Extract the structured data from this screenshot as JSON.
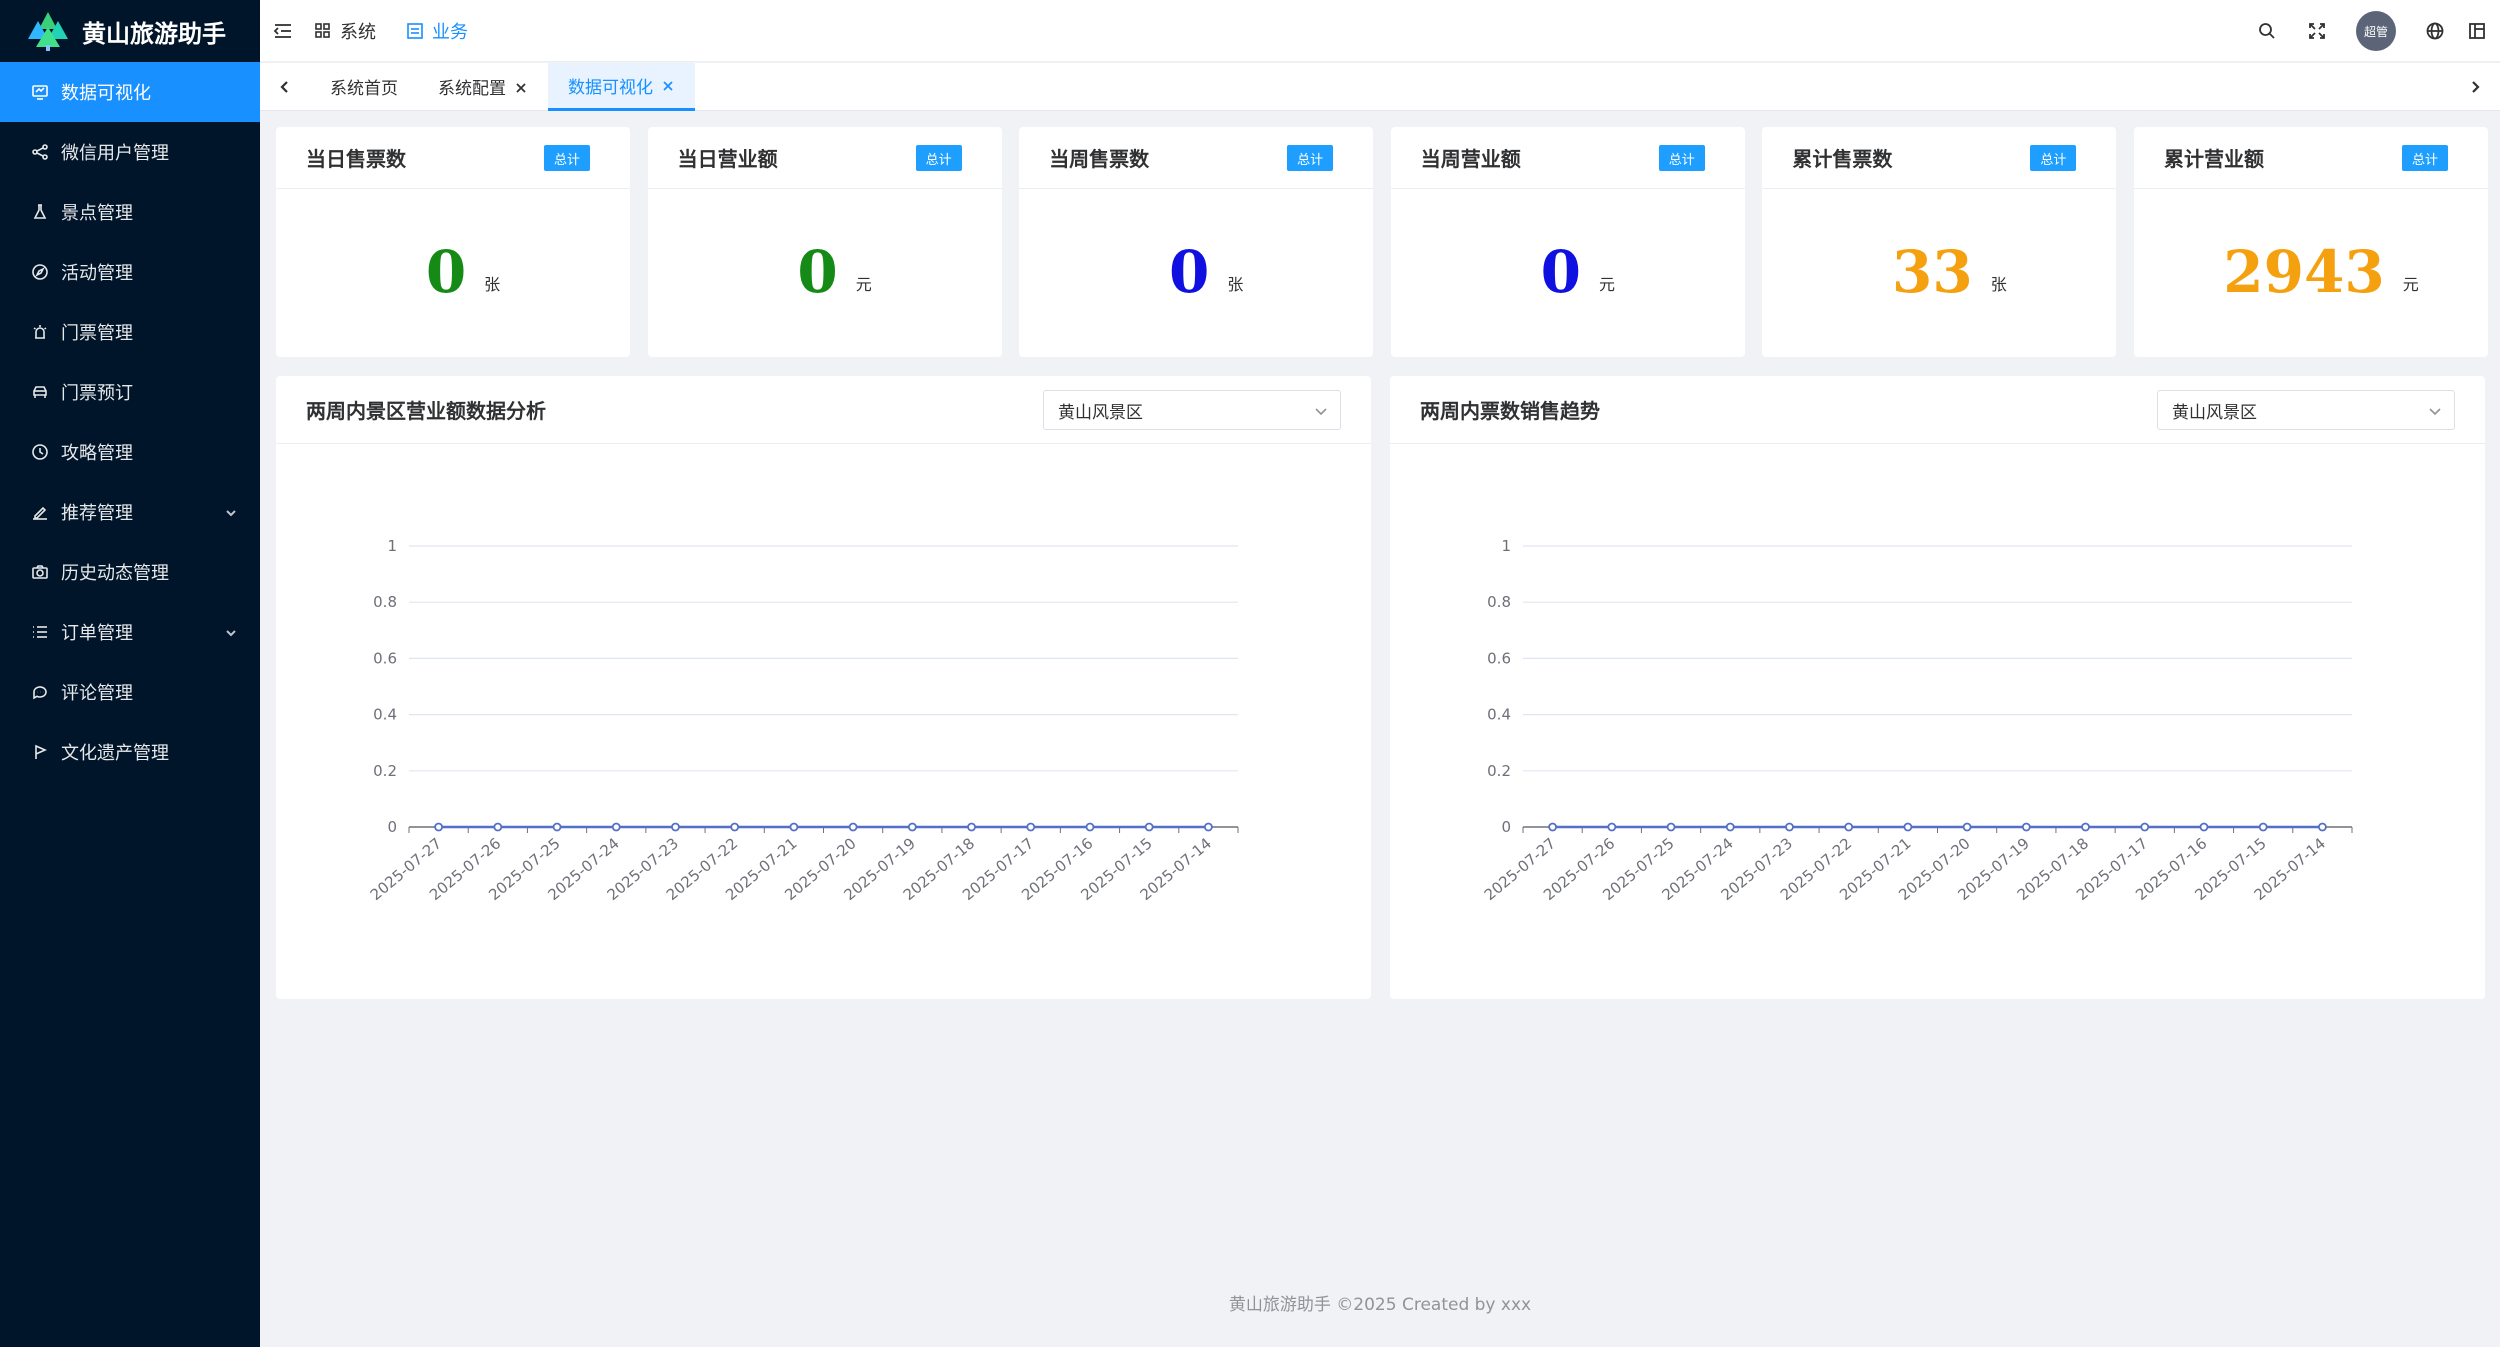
{
  "app": {
    "title": "黄山旅游助手"
  },
  "sidebar": {
    "items": [
      {
        "label": "数据可视化",
        "icon": "monitor-icon",
        "active": true
      },
      {
        "label": "微信用户管理",
        "icon": "share-nodes-icon"
      },
      {
        "label": "景点管理",
        "icon": "flask-icon"
      },
      {
        "label": "活动管理",
        "icon": "compass-icon"
      },
      {
        "label": "门票管理",
        "icon": "alarm-icon"
      },
      {
        "label": "门票预订",
        "icon": "car-icon"
      },
      {
        "label": "攻略管理",
        "icon": "clock-icon"
      },
      {
        "label": "推荐管理",
        "icon": "pen-icon",
        "expandable": true
      },
      {
        "label": "历史动态管理",
        "icon": "camera-icon"
      },
      {
        "label": "订单管理",
        "icon": "list-icon",
        "expandable": true
      },
      {
        "label": "评论管理",
        "icon": "chat-icon"
      },
      {
        "label": "文化遗产管理",
        "icon": "flag-icon"
      }
    ]
  },
  "header": {
    "menu_toggle_icon": "menu-fold-icon",
    "nav": [
      {
        "label": "系统",
        "icon": "grid-icon",
        "active": false
      },
      {
        "label": "业务",
        "icon": "document-icon",
        "active": true
      }
    ],
    "avatar_text": "超管",
    "right_icons": [
      "search-icon",
      "fullscreen-icon",
      "globe-icon",
      "layout-icon"
    ]
  },
  "tabs": [
    {
      "label": "系统首页",
      "closable": false,
      "active": false
    },
    {
      "label": "系统配置",
      "closable": true,
      "active": false
    },
    {
      "label": "数据可视化",
      "closable": true,
      "active": true
    }
  ],
  "stats": [
    {
      "title": "当日售票数",
      "tag": "总计",
      "value": "0",
      "unit": "张",
      "color": "#168a16"
    },
    {
      "title": "当日营业额",
      "tag": "总计",
      "value": "0",
      "unit": "元",
      "color": "#168a16"
    },
    {
      "title": "当周售票数",
      "tag": "总计",
      "value": "0",
      "unit": "张",
      "color": "#1010e0"
    },
    {
      "title": "当周营业额",
      "tag": "总计",
      "value": "0",
      "unit": "元",
      "color": "#1010e0"
    },
    {
      "title": "累计售票数",
      "tag": "总计",
      "value": "33",
      "unit": "张",
      "color": "#f5a00f"
    },
    {
      "title": "累计营业额",
      "tag": "总计",
      "value": "2943",
      "unit": "元",
      "color": "#f5a00f"
    }
  ],
  "charts": [
    {
      "title": "两周内景区营业额数据分析",
      "select_value": "黄山风景区"
    },
    {
      "title": "两周内票数销售趋势",
      "select_value": "黄山风景区"
    }
  ],
  "chart_data": [
    {
      "type": "line",
      "title": "两周内景区营业额数据分析",
      "x": [
        "2025-07-27",
        "2025-07-26",
        "2025-07-25",
        "2025-07-24",
        "2025-07-23",
        "2025-07-22",
        "2025-07-21",
        "2025-07-20",
        "2025-07-19",
        "2025-07-18",
        "2025-07-17",
        "2025-07-16",
        "2025-07-15",
        "2025-07-14"
      ],
      "values": [
        0,
        0,
        0,
        0,
        0,
        0,
        0,
        0,
        0,
        0,
        0,
        0,
        0,
        0
      ],
      "yticks": [
        "0",
        "0.2",
        "0.4",
        "0.6",
        "0.8",
        "1"
      ],
      "ylim": [
        0,
        1
      ],
      "grid": true,
      "color": "#5470c6"
    },
    {
      "type": "line",
      "title": "两周内票数销售趋势",
      "x": [
        "2025-07-27",
        "2025-07-26",
        "2025-07-25",
        "2025-07-24",
        "2025-07-23",
        "2025-07-22",
        "2025-07-21",
        "2025-07-20",
        "2025-07-19",
        "2025-07-18",
        "2025-07-17",
        "2025-07-16",
        "2025-07-15",
        "2025-07-14"
      ],
      "values": [
        0,
        0,
        0,
        0,
        0,
        0,
        0,
        0,
        0,
        0,
        0,
        0,
        0,
        0
      ],
      "yticks": [
        "0",
        "0.2",
        "0.4",
        "0.6",
        "0.8",
        "1"
      ],
      "ylim": [
        0,
        1
      ],
      "grid": true,
      "color": "#5470c6"
    }
  ],
  "footer": {
    "text": "黄山旅游助手 ©2025 Created by xxx"
  }
}
